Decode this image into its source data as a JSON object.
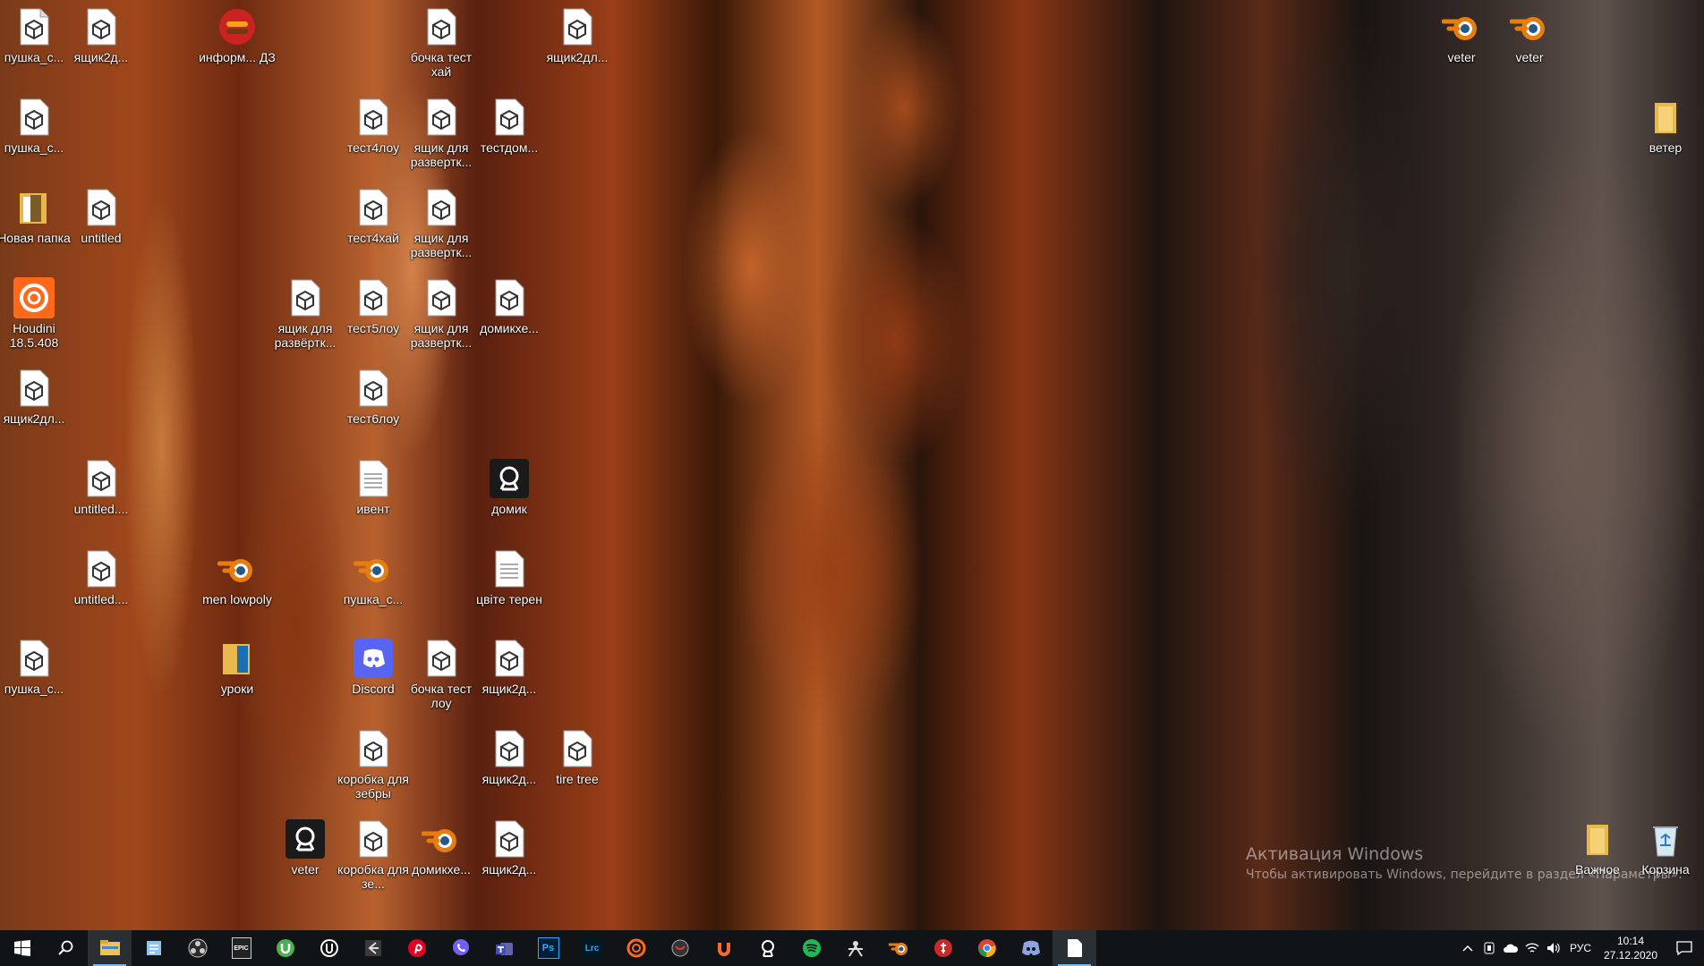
{
  "desktop": {
    "icons": [
      {
        "label": "пушка_с...",
        "type": "blend-file"
      },
      {
        "label": "ящик2д...",
        "type": "blend-file"
      },
      {
        "label": "информ... ДЗ",
        "type": "app"
      },
      {
        "label": "бочка тест хай",
        "type": "blend-file"
      },
      {
        "label": "ящик2дл...",
        "type": "blend-file"
      },
      {
        "label": "veter",
        "type": "blender"
      },
      {
        "label": "veter",
        "type": "blender"
      },
      {
        "label": "пушка_с...",
        "type": "blend-file"
      },
      {
        "label": "тест4лоу",
        "type": "blend-file"
      },
      {
        "label": "ящик для развертк...",
        "type": "blend-file"
      },
      {
        "label": "тестдом...",
        "type": "blend-file"
      },
      {
        "label": "ветер",
        "type": "folder"
      },
      {
        "label": "Новая папка",
        "type": "folder"
      },
      {
        "label": "untitled",
        "type": "blend-file"
      },
      {
        "label": "тест4хай",
        "type": "blend-file"
      },
      {
        "label": "ящик для развертк...",
        "type": "blend-file"
      },
      {
        "label": "Houdini 18.5.408",
        "type": "houdini"
      },
      {
        "label": "ящик для развёртк...",
        "type": "blend-file"
      },
      {
        "label": "тест5лоу",
        "type": "blend-file"
      },
      {
        "label": "ящик для развертк...",
        "type": "blend-file"
      },
      {
        "label": "домикхе...",
        "type": "blend-file"
      },
      {
        "label": "ящик2дл...",
        "type": "blend-file"
      },
      {
        "label": "тест6лоу",
        "type": "blend-file"
      },
      {
        "label": "untitled....",
        "type": "blend-file"
      },
      {
        "label": "ивент",
        "type": "text-file"
      },
      {
        "label": "домик",
        "type": "substance"
      },
      {
        "label": "untitled....",
        "type": "blend-file"
      },
      {
        "label": "men lowpoly",
        "type": "blender"
      },
      {
        "label": "пушка_с...",
        "type": "blender"
      },
      {
        "label": "цвіте терен",
        "type": "text-file"
      },
      {
        "label": "пушка_с...",
        "type": "blend-file"
      },
      {
        "label": "уроки",
        "type": "folder"
      },
      {
        "label": "Discord",
        "type": "discord"
      },
      {
        "label": "бочка тест лоу",
        "type": "blend-file"
      },
      {
        "label": "ящик2д...",
        "type": "blend-file"
      },
      {
        "label": "коробка для зебры",
        "type": "blend-file"
      },
      {
        "label": "ящик2д...",
        "type": "blend-file"
      },
      {
        "label": "tire tree",
        "type": "blend-file"
      },
      {
        "label": "veter",
        "type": "substance"
      },
      {
        "label": "коробка для зе...",
        "type": "blend-file"
      },
      {
        "label": "домикхе...",
        "type": "blender"
      },
      {
        "label": "ящик2д...",
        "type": "blend-file"
      },
      {
        "label": "Важное",
        "type": "folder"
      },
      {
        "label": "Корзина",
        "type": "recycle-bin"
      }
    ]
  },
  "watermark": {
    "title": "Активация Windows",
    "subtitle": "Чтобы активировать Windows, перейдите в раздел «Параметры»."
  },
  "taskbar": {
    "apps": [
      "windows-start-icon",
      "search-icon",
      "file-explorer-icon",
      "notepad-icon",
      "obs-icon",
      "epic-games-icon",
      "utorrent-icon",
      "unreal-engine-icon",
      "vs-code-icon",
      "pinterest-icon",
      "viber-icon",
      "teams-icon",
      "photoshop-icon",
      "lightroom-classic-icon",
      "houdini-icon",
      "unity-icon",
      "origin-icon",
      "substance-icon",
      "spotify-icon",
      "zbrush-icon",
      "blender-icon",
      "steam-icon",
      "chrome-icon",
      "discord-icon",
      "document-icon"
    ],
    "ps_label": "Ps",
    "lrc_label": "Lrc",
    "epic_label": "EPIC",
    "language": "РУС",
    "time": "10:14",
    "date": "27.12.2020"
  },
  "colors": {
    "taskbar_bg": "#101417",
    "blender_orange": "#e87d0d",
    "discord_blurple": "#5865f2"
  }
}
